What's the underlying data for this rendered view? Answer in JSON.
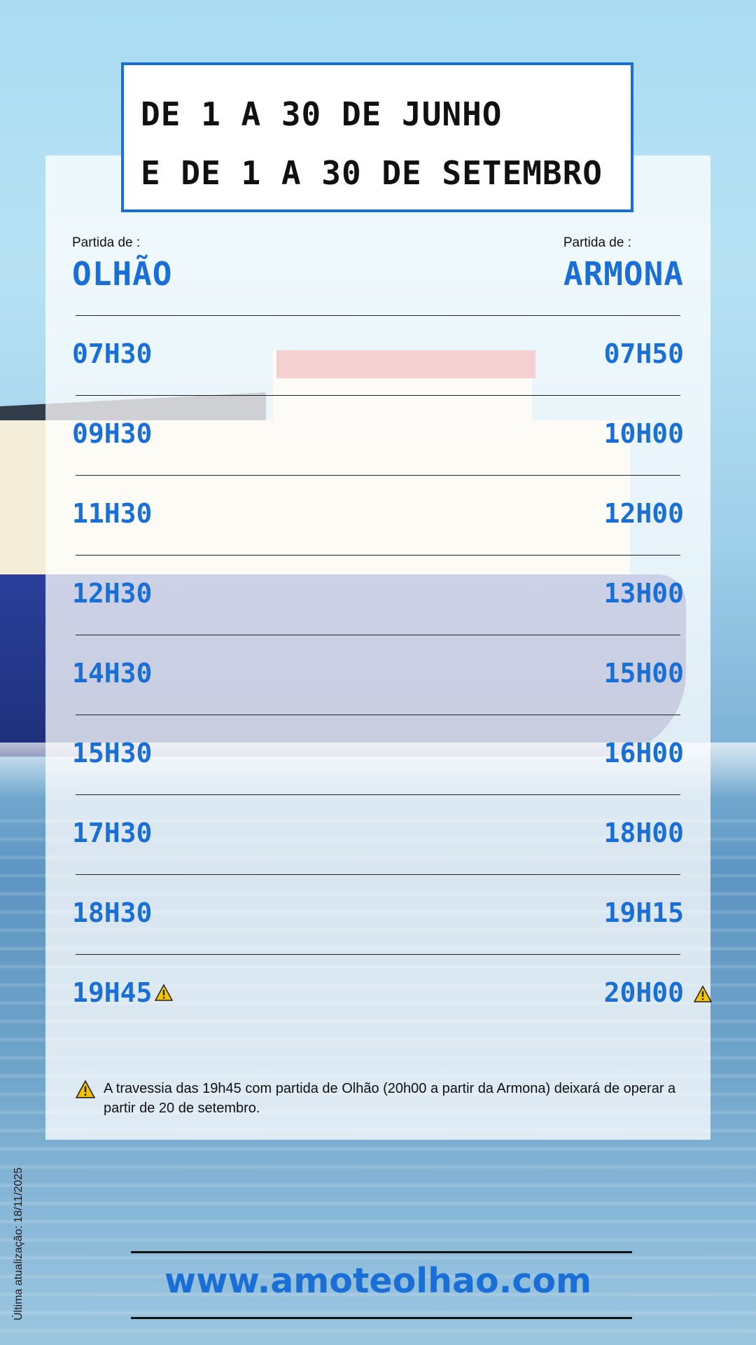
{
  "period": {
    "line1": "DE 1 A 30 DE JUNHO",
    "line2": "E DE 1 A 30 DE SETEMBRO"
  },
  "columns": {
    "left": {
      "caption": "Partida de :",
      "place": "OLHÃO"
    },
    "right": {
      "caption": "Partida de :",
      "place": "ARMONA"
    }
  },
  "schedule": [
    {
      "olhao": "07H30",
      "armona": "07H50"
    },
    {
      "olhao": "09H30",
      "armona": "10H00"
    },
    {
      "olhao": "11H30",
      "armona": "12H00"
    },
    {
      "olhao": "12H30",
      "armona": "13H00"
    },
    {
      "olhao": "14H30",
      "armona": "15H00"
    },
    {
      "olhao": "15H30",
      "armona": "16H00"
    },
    {
      "olhao": "17H30",
      "armona": "18H00"
    },
    {
      "olhao": "18H30",
      "armona": "19H15"
    },
    {
      "olhao": "19H45",
      "armona": "20H00",
      "warning": true
    }
  ],
  "note": "A travessia das 19h45 com partida de Olhão (20h00 a partir da Armona) deixará de operar a partir de 20 de setembro.",
  "last_update": "Última atualização: 18/11/2025",
  "website": "www.amoteolhao.com",
  "colors": {
    "accent": "#1a6fd6",
    "warning": "#f5c400"
  },
  "icons": {
    "warning": "warning-triangle-icon"
  }
}
